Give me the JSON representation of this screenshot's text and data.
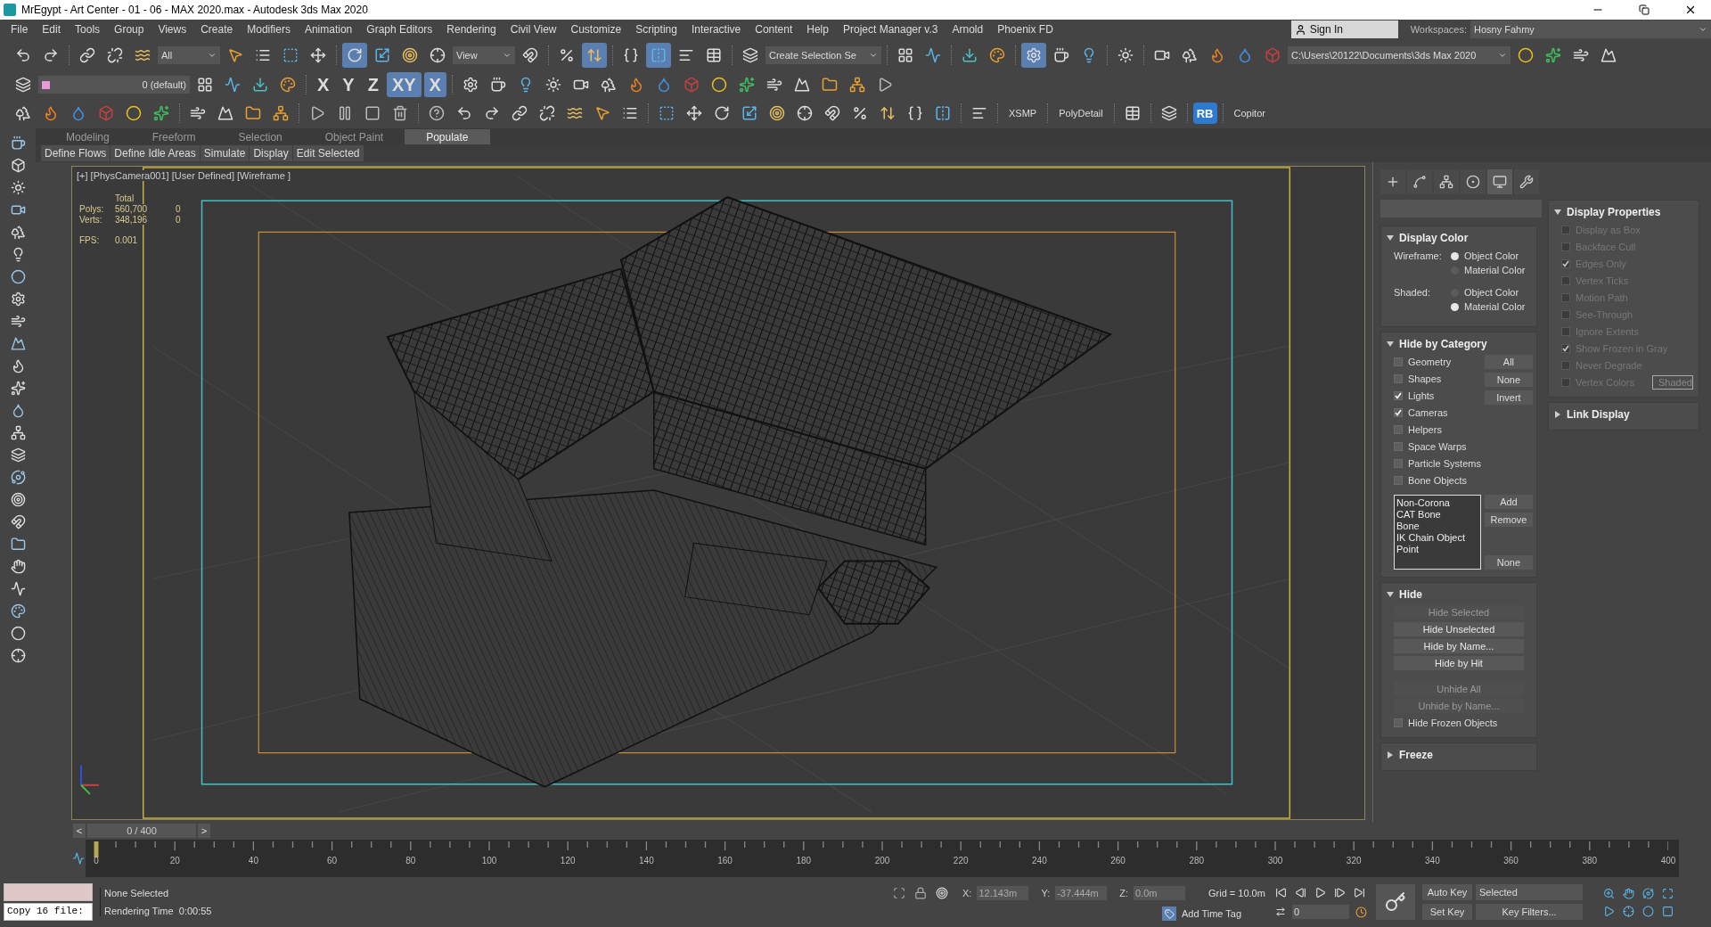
{
  "window": {
    "title": "MrEgypt - Art Center - 01 - 06 - MAX 2020.max - Autodesk 3ds Max 2020"
  },
  "menu": [
    "File",
    "Edit",
    "Tools",
    "Group",
    "Views",
    "Create",
    "Modifiers",
    "Animation",
    "Graph Editors",
    "Rendering",
    "Civil View",
    "Customize",
    "Scripting",
    "Interactive",
    "Content",
    "Help",
    "Project Manager v.3",
    "Arnold",
    "Phoenix FD"
  ],
  "account": {
    "label": "Sign In"
  },
  "workspaces": {
    "label": "Workspaces:",
    "value": "Hosny Fahmy"
  },
  "toolbar_main": [
    {
      "kind": "icon",
      "selected": false
    },
    {
      "kind": "icon",
      "selected": false
    },
    {
      "kind": "sep"
    },
    {
      "kind": "icon",
      "selected": false
    },
    {
      "kind": "icon",
      "selected": false
    },
    {
      "kind": "icon",
      "selected": false
    },
    {
      "kind": "dropdown",
      "value": "All",
      "wide": false
    },
    {
      "kind": "icon",
      "selected": false
    },
    {
      "kind": "icon",
      "selected": false
    },
    {
      "kind": "icon",
      "selected": false
    },
    {
      "kind": "icon",
      "selected": false
    },
    {
      "kind": "sep"
    },
    {
      "kind": "icon",
      "selected": true
    },
    {
      "kind": "icon",
      "selected": false
    },
    {
      "kind": "icon",
      "selected": false
    },
    {
      "kind": "icon",
      "selected": false
    },
    {
      "kind": "dropdown",
      "value": "View",
      "wide": false
    },
    {
      "kind": "icon",
      "selected": false
    },
    {
      "kind": "sep"
    },
    {
      "kind": "icon",
      "selected": false
    },
    {
      "kind": "icon",
      "selected": true
    },
    {
      "kind": "sep"
    },
    {
      "kind": "icon",
      "selected": false
    },
    {
      "kind": "icon",
      "selected": true
    },
    {
      "kind": "icon",
      "selected": false
    },
    {
      "kind": "icon",
      "selected": false
    },
    {
      "kind": "sep"
    },
    {
      "kind": "icon",
      "selected": false
    },
    {
      "kind": "dropdown",
      "value": "Create Selection Se",
      "wide": false
    },
    {
      "kind": "sep"
    },
    {
      "kind": "icon",
      "selected": false
    },
    {
      "kind": "icon",
      "selected": false
    },
    {
      "kind": "sep"
    },
    {
      "kind": "icon",
      "selected": false
    },
    {
      "kind": "icon",
      "selected": false
    },
    {
      "kind": "sep"
    },
    {
      "kind": "icon",
      "selected": true
    },
    {
      "kind": "icon",
      "selected": false
    },
    {
      "kind": "icon",
      "selected": false
    },
    {
      "kind": "sep"
    },
    {
      "kind": "icon",
      "selected": false
    },
    {
      "kind": "sep"
    },
    {
      "kind": "icon",
      "selected": false
    },
    {
      "kind": "icon",
      "selected": false
    },
    {
      "kind": "icon",
      "selected": false
    },
    {
      "kind": "icon",
      "selected": false
    },
    {
      "kind": "icon",
      "selected": false
    },
    {
      "kind": "dropdown",
      "value": "C:\\Users\\20122\\Documents\\3ds Max 2020",
      "wide": true
    },
    {
      "kind": "icon",
      "selected": false
    },
    {
      "kind": "icon",
      "selected": false
    },
    {
      "kind": "icon",
      "selected": false
    },
    {
      "kind": "icon",
      "selected": false
    }
  ],
  "toolbar_second": [
    {
      "kind": "icon",
      "selected": false
    },
    {
      "kind": "layer",
      "value": "0 (default)"
    },
    {
      "kind": "icon",
      "selected": false
    },
    {
      "kind": "icon",
      "selected": false
    },
    {
      "kind": "icon",
      "selected": false
    },
    {
      "kind": "icon",
      "selected": false
    },
    {
      "kind": "sep"
    },
    {
      "kind": "text",
      "text": "X",
      "selected": false
    },
    {
      "kind": "text",
      "text": "Y",
      "selected": false
    },
    {
      "kind": "text",
      "text": "Z",
      "selected": false
    },
    {
      "kind": "text",
      "text": "XY",
      "selected": true
    },
    {
      "kind": "text",
      "text": "X",
      "selected": true
    },
    {
      "kind": "sep"
    },
    {
      "kind": "icon",
      "selected": false
    },
    {
      "kind": "icon",
      "selected": false
    },
    {
      "kind": "icon",
      "selected": false
    },
    {
      "kind": "icon",
      "selected": false
    },
    {
      "kind": "icon",
      "selected": false
    },
    {
      "kind": "icon",
      "selected": false
    },
    {
      "kind": "icon",
      "selected": false
    },
    {
      "kind": "icon",
      "selected": false
    },
    {
      "kind": "icon",
      "selected": false
    },
    {
      "kind": "icon",
      "selected": false
    },
    {
      "kind": "icon",
      "selected": false
    },
    {
      "kind": "icon",
      "selected": false
    },
    {
      "kind": "icon",
      "selected": false
    },
    {
      "kind": "icon",
      "selected": false
    },
    {
      "kind": "icon",
      "selected": false
    },
    {
      "kind": "icon",
      "selected": false
    }
  ],
  "toolbar_third": [
    {
      "kind": "icon",
      "selected": false
    },
    {
      "kind": "icon",
      "selected": false
    },
    {
      "kind": "icon",
      "selected": false
    },
    {
      "kind": "icon",
      "selected": false
    },
    {
      "kind": "icon",
      "selected": false
    },
    {
      "kind": "icon",
      "selected": false
    },
    {
      "kind": "sep"
    },
    {
      "kind": "icon",
      "selected": false
    },
    {
      "kind": "icon",
      "selected": false
    },
    {
      "kind": "icon",
      "selected": false
    },
    {
      "kind": "icon",
      "selected": false
    },
    {
      "kind": "sep"
    },
    {
      "kind": "icon",
      "selected": false
    },
    {
      "kind": "icon",
      "selected": false
    },
    {
      "kind": "icon",
      "selected": false
    },
    {
      "kind": "icon",
      "selected": false
    },
    {
      "kind": "sep"
    },
    {
      "kind": "icon",
      "selected": false
    },
    {
      "kind": "icon",
      "selected": false
    },
    {
      "kind": "icon",
      "selected": false
    },
    {
      "kind": "icon",
      "selected": false
    },
    {
      "kind": "icon",
      "selected": false
    },
    {
      "kind": "icon",
      "selected": false
    },
    {
      "kind": "icon",
      "selected": false
    },
    {
      "kind": "icon",
      "selected": false
    },
    {
      "kind": "sep"
    },
    {
      "kind": "icon",
      "selected": false
    },
    {
      "kind": "icon",
      "selected": false
    },
    {
      "kind": "icon",
      "selected": false
    },
    {
      "kind": "icon",
      "selected": false
    },
    {
      "kind": "icon",
      "selected": false
    },
    {
      "kind": "icon",
      "selected": false
    },
    {
      "kind": "icon",
      "selected": false
    },
    {
      "kind": "icon",
      "selected": false
    },
    {
      "kind": "icon",
      "selected": false
    },
    {
      "kind": "icon",
      "selected": false
    },
    {
      "kind": "icon",
      "selected": false
    },
    {
      "kind": "sep"
    },
    {
      "kind": "icon",
      "selected": false
    },
    {
      "kind": "sep"
    },
    {
      "kind": "text",
      "text": "XSMP",
      "selected": false
    },
    {
      "kind": "sep"
    },
    {
      "kind": "text",
      "text": "PolyDetail",
      "selected": false
    },
    {
      "kind": "sep"
    },
    {
      "kind": "icon",
      "selected": false
    },
    {
      "kind": "sep"
    },
    {
      "kind": "icon",
      "selected": false
    },
    {
      "kind": "sep"
    },
    {
      "kind": "badge",
      "text": "RB"
    },
    {
      "kind": "sep"
    },
    {
      "kind": "text",
      "text": "Copitor",
      "selected": false
    }
  ],
  "ribbon": {
    "tabs": [
      {
        "label": "Modeling",
        "selected": false
      },
      {
        "label": "Freeform",
        "selected": false
      },
      {
        "label": "Selection",
        "selected": false
      },
      {
        "label": "Object Paint",
        "selected": false
      },
      {
        "label": "Populate",
        "selected": true
      }
    ],
    "buttons": [
      "Define Flows",
      "Define Idle Areas",
      "Simulate",
      "Display",
      "Edit Selected"
    ]
  },
  "viewport": {
    "label": "[+] [PhysCamera001] [User Defined] [Wireframe ]",
    "stats": {
      "header": "Total",
      "rows": [
        {
          "label": "Polys:",
          "total": "560,700",
          "selected": "0"
        },
        {
          "label": "Verts:",
          "total": "348,196",
          "selected": "0"
        }
      ],
      "fps_label": "FPS:",
      "fps": "0.001"
    }
  },
  "command_panel": {
    "tabs": [
      {
        "selected": false
      },
      {
        "selected": false
      },
      {
        "selected": false
      },
      {
        "selected": false
      },
      {
        "selected": true
      },
      {
        "selected": false
      }
    ],
    "display_color": {
      "title": "Display Color",
      "expanded": true,
      "groups": [
        {
          "label": "Wireframe:",
          "options": [
            {
              "label": "Object Color",
              "selected": true
            },
            {
              "label": "Material Color",
              "selected": false
            }
          ]
        },
        {
          "label": "Shaded:",
          "options": [
            {
              "label": "Object Color",
              "selected": false
            },
            {
              "label": "Material Color",
              "selected": true
            }
          ]
        }
      ]
    },
    "hide_by_category": {
      "title": "Hide by Category",
      "expanded": true,
      "items": [
        {
          "label": "Geometry",
          "checked": false
        },
        {
          "label": "Shapes",
          "checked": false
        },
        {
          "label": "Lights",
          "checked": true
        },
        {
          "label": "Cameras",
          "checked": true
        },
        {
          "label": "Helpers",
          "checked": false
        },
        {
          "label": "Space Warps",
          "checked": false
        },
        {
          "label": "Particle Systems",
          "checked": false
        },
        {
          "label": "Bone Objects",
          "checked": false
        }
      ],
      "buttons": [
        "All",
        "None",
        "Invert"
      ],
      "list": [
        "Non-Corona",
        "CAT Bone",
        "Bone",
        "IK Chain Object",
        "Point"
      ],
      "list_buttons": [
        "Add",
        "Remove",
        "None"
      ]
    },
    "hide": {
      "title": "Hide",
      "expanded": true,
      "buttons": [
        {
          "label": "Hide Selected",
          "disabled": true
        },
        {
          "label": "Hide Unselected",
          "disabled": false
        },
        {
          "label": "Hide by Name...",
          "disabled": false
        },
        {
          "label": "Hide by Hit",
          "disabled": false
        },
        {
          "label": "Unhide All",
          "disabled": true
        },
        {
          "label": "Unhide by Name...",
          "disabled": true
        }
      ],
      "checkbox": {
        "label": "Hide Frozen Objects",
        "checked": false
      }
    },
    "freeze": {
      "title": "Freeze",
      "expanded": false
    },
    "display_properties": {
      "title": "Display Properties",
      "expanded": true,
      "items": [
        {
          "label": "Display as Box",
          "checked": false,
          "disabled": true
        },
        {
          "label": "Backface Cull",
          "checked": false,
          "disabled": true
        },
        {
          "label": "Edges Only",
          "checked": true,
          "disabled": true
        },
        {
          "label": "Vertex Ticks",
          "checked": false,
          "disabled": true
        },
        {
          "label": "Motion Path",
          "checked": false,
          "disabled": true
        },
        {
          "label": "See-Through",
          "checked": false,
          "disabled": true
        },
        {
          "label": "Ignore Extents",
          "checked": false,
          "disabled": true
        },
        {
          "label": "Show Frozen in Gray",
          "checked": true,
          "disabled": true
        },
        {
          "label": "Never Degrade",
          "checked": false,
          "disabled": true
        },
        {
          "label": "Vertex Colors",
          "checked": false,
          "disabled": true
        }
      ],
      "shaded_button": "Shaded"
    },
    "link_display": {
      "title": "Link Display",
      "expanded": false
    }
  },
  "time_slider": {
    "prev": "<",
    "label": "0 / 400",
    "next": ">",
    "level": 0
  },
  "timeline": {
    "ticks": [
      "0",
      "20",
      "40",
      "60",
      "80",
      "100",
      "120",
      "140",
      "160",
      "180",
      "200",
      "220",
      "240",
      "260",
      "280",
      "300",
      "320",
      "340",
      "360",
      "380",
      "400"
    ]
  },
  "status": {
    "listener_output": "Copy 16 file:",
    "selection": "None Selected",
    "render_time": "Rendering Time  0:00:55",
    "coords": [
      {
        "label": "X:",
        "value": "12.143m"
      },
      {
        "label": "Y:",
        "value": "-37.444m"
      },
      {
        "label": "Z:",
        "value": "0.0m"
      }
    ],
    "grid": "Grid = 10.0m",
    "time_tag": "Add Time Tag",
    "frame": "0",
    "auto_key": "Auto Key",
    "key_mode": "Selected",
    "set_key": "Set Key",
    "key_filters": "Key Filters..."
  }
}
